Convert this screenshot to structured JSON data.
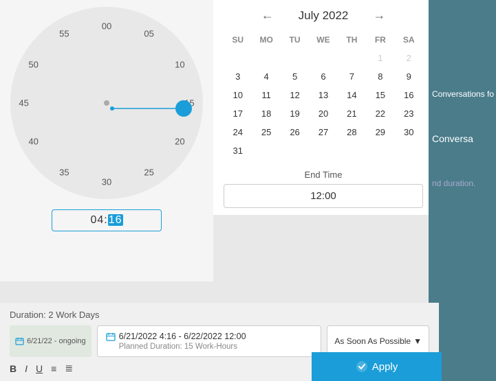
{
  "calendar": {
    "title": "July 2022",
    "days_header": [
      "SU",
      "MO",
      "TU",
      "WE",
      "TH",
      "FR",
      "SA"
    ],
    "weeks": [
      [
        null,
        null,
        null,
        null,
        null,
        "1",
        "2"
      ],
      [
        "3",
        "4",
        "5",
        "6",
        "7",
        "8",
        "9"
      ],
      [
        "10",
        "11",
        "12",
        "13",
        "14",
        "15",
        "16"
      ],
      [
        "17",
        "18",
        "19",
        "20",
        "21",
        "22",
        "23"
      ],
      [
        "24",
        "25",
        "26",
        "27",
        "28",
        "29",
        "30"
      ],
      [
        "31",
        null,
        null,
        null,
        null,
        null,
        null
      ]
    ],
    "muted_end": [
      "2"
    ]
  },
  "end_time": {
    "label": "End Time",
    "value": "12:00"
  },
  "time_display": {
    "hours": "04",
    "minutes": "16"
  },
  "duration": {
    "label": "Duration: 2 Work Days"
  },
  "date_range_box": {
    "main": "6/21/2022 4:16 - 6/22/2022 12:00",
    "sub": "Planned Duration: 15 Work-Hours"
  },
  "sidebar_left": {
    "label": "6/21/22 - ongoing"
  },
  "dropdown": {
    "label": "As Soon As Possible"
  },
  "apply_button": {
    "label": "Apply"
  },
  "toolbar": {
    "bold": "B",
    "italic": "I",
    "underline": "U",
    "list_ol": "≡",
    "list_ul": "≣"
  },
  "right_sidebar": {
    "text1": "Conversations fo",
    "text2": "Conversa",
    "text3": "nd duration."
  },
  "colors": {
    "accent": "#1a9dd9",
    "sidebar_bg": "#4a7c8a"
  }
}
